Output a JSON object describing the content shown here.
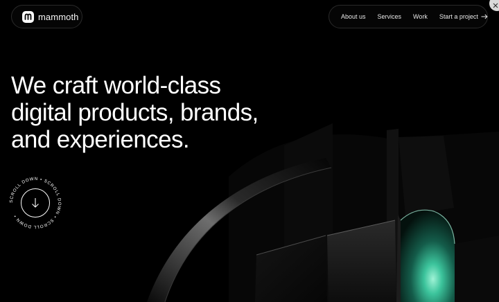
{
  "brand": {
    "name": "mammoth"
  },
  "nav": {
    "items": [
      {
        "label": "About us"
      },
      {
        "label": "Services"
      },
      {
        "label": "Work"
      }
    ],
    "cta": {
      "label": "Start a project",
      "icon": "arrow-right-icon"
    }
  },
  "hero": {
    "lines": [
      "We craft world-class",
      "digital products, brands,",
      "and experiences."
    ]
  },
  "scroll": {
    "text": "SCROLL DOWN • SCROLL DOWN • SCROLL DOWN • ",
    "icon": "arrow-down-icon"
  },
  "colors": {
    "background": "#000000",
    "text": "#ffffff",
    "accent": "#2fb892",
    "pill_border": "#2a2a2a"
  }
}
